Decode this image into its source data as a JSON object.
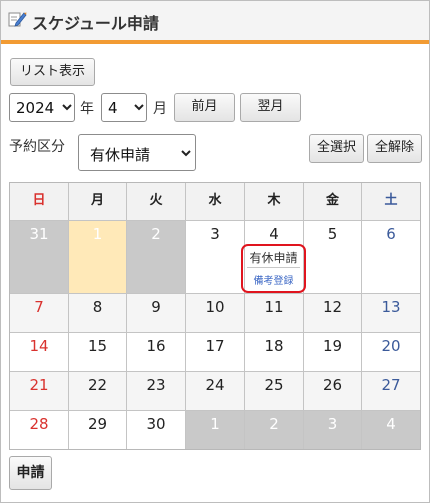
{
  "header": {
    "title": "スケジュール申請"
  },
  "toolbar": {
    "list_button": "リスト表示",
    "year_value": "2024",
    "year_label": "年",
    "month_value": "4",
    "month_label": "月",
    "prev_button": "前月",
    "next_button": "翌月",
    "category_label": "予約区分",
    "category_value": "有休申請",
    "select_all_button": "全選択",
    "clear_all_button": "全解除"
  },
  "calendar": {
    "weekdays": [
      "日",
      "月",
      "火",
      "水",
      "木",
      "金",
      "土"
    ],
    "weeks": [
      [
        "31",
        "1",
        "2",
        "3",
        "4",
        "5",
        "6"
      ],
      [
        "7",
        "8",
        "9",
        "10",
        "11",
        "12",
        "13"
      ],
      [
        "14",
        "15",
        "16",
        "17",
        "18",
        "19",
        "20"
      ],
      [
        "21",
        "22",
        "23",
        "24",
        "25",
        "26",
        "27"
      ],
      [
        "28",
        "29",
        "30",
        "1",
        "2",
        "3",
        "4"
      ]
    ],
    "entry": {
      "label": "有休申請",
      "link": "備考登録"
    }
  },
  "footer": {
    "apply_button": "申請"
  },
  "colors": {
    "accent": "#f29b33",
    "highlight": "#e0141e",
    "sunday": "#d9322e",
    "saturday": "#3b5a9a",
    "today": "#ffe9b8"
  }
}
